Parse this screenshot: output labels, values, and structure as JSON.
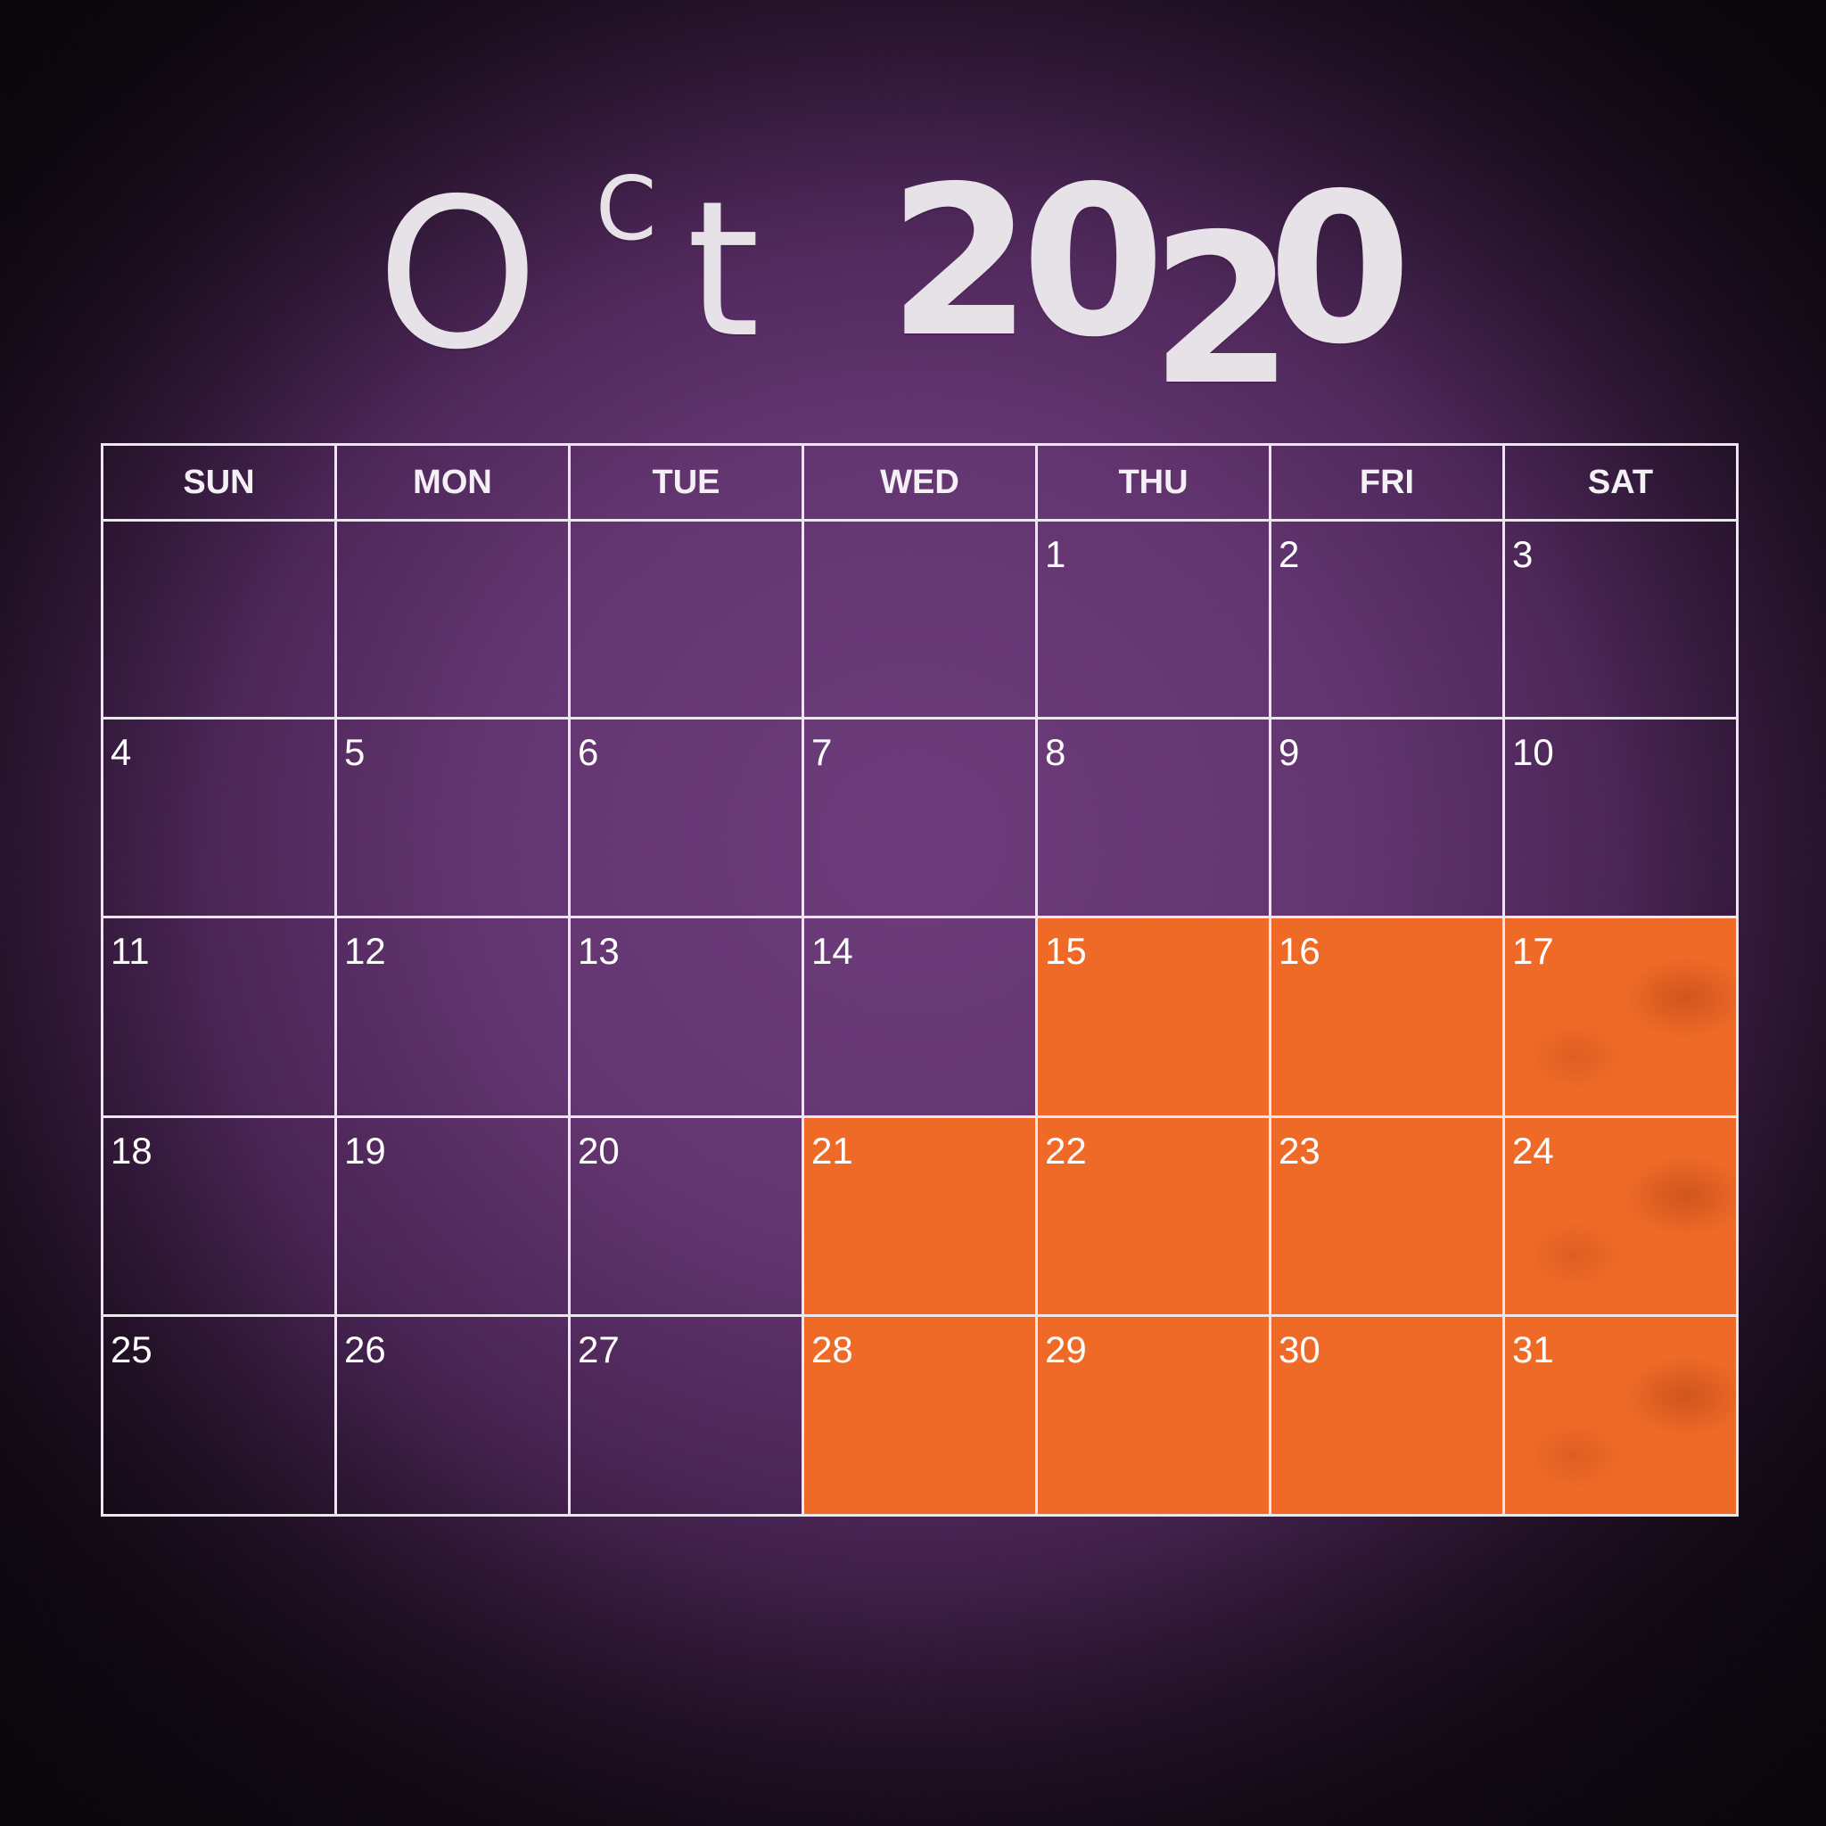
{
  "title": {
    "month_o": "O",
    "month_c": "C",
    "month_t": "t",
    "year_part1": "20",
    "year_part2a": "2",
    "year_part2b": "0"
  },
  "calendar": {
    "weekdays": [
      "SUN",
      "MON",
      "TUE",
      "WED",
      "THU",
      "FRI",
      "SAT"
    ],
    "weeks": [
      [
        "",
        "",
        "",
        "",
        "1",
        "2",
        "3"
      ],
      [
        "4",
        "5",
        "6",
        "7",
        "8",
        "9",
        "10"
      ],
      [
        "11",
        "12",
        "13",
        "14",
        "15",
        "16",
        "17"
      ],
      [
        "18",
        "19",
        "20",
        "21",
        "22",
        "23",
        "24"
      ],
      [
        "25",
        "26",
        "27",
        "28",
        "29",
        "30",
        "31"
      ]
    ],
    "highlighted_days": [
      "15",
      "16",
      "17",
      "21",
      "22",
      "23",
      "24",
      "28",
      "29",
      "30",
      "31"
    ]
  },
  "colors": {
    "background": "#623470",
    "grid_lines": "#ece6ee",
    "highlight": "#ef6a27",
    "title_text": "#e6e2e8"
  }
}
